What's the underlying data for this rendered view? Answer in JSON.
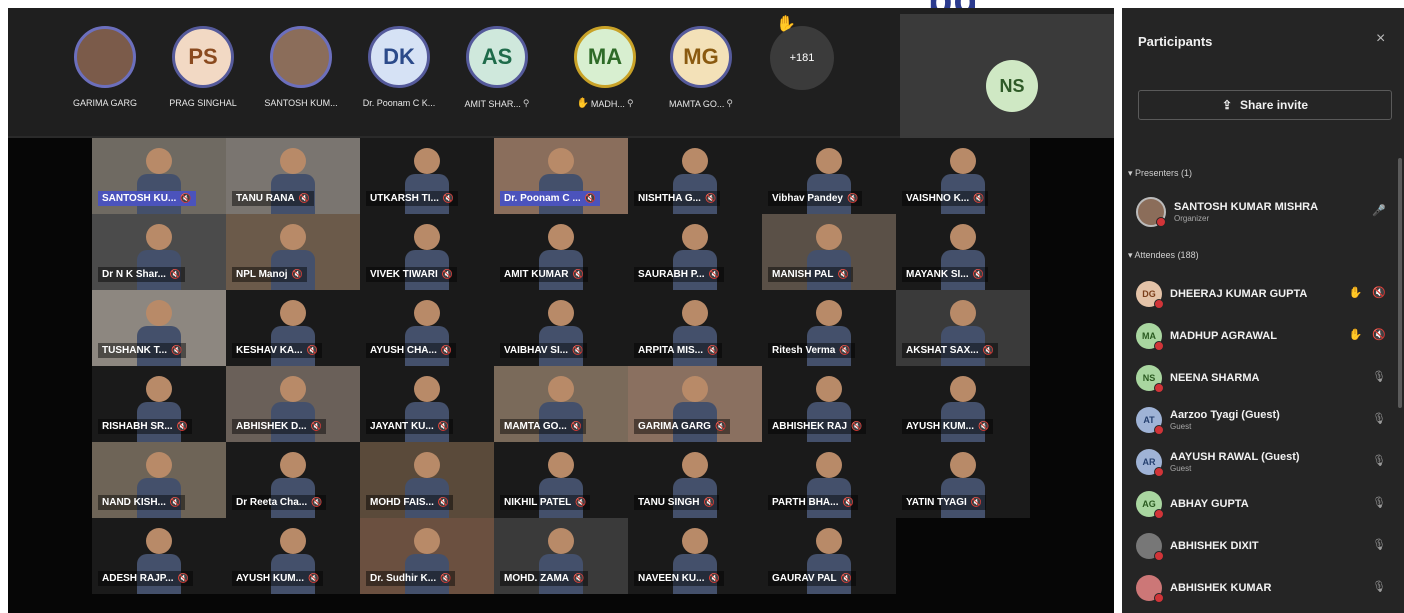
{
  "overlay_text": "p",
  "overlay_text2": "pg",
  "topbar": {
    "participants": [
      {
        "name": "GARIMA GARG",
        "initials": "",
        "photo": true,
        "bg": "#7b5b4a",
        "color": "#fff",
        "pinned": false,
        "hand": false
      },
      {
        "name": "PRAG SINGHAL",
        "initials": "PS",
        "photo": false,
        "bg": "#f2d9c4",
        "color": "#8a4a1f",
        "pinned": false,
        "hand": false
      },
      {
        "name": "SANTOSH KUM...",
        "initials": "",
        "photo": true,
        "bg": "#8b6d5a",
        "color": "#fff",
        "pinned": false,
        "hand": false
      },
      {
        "name": "Dr. Poonam C K...",
        "initials": "DK",
        "photo": false,
        "bg": "#d6e2f5",
        "color": "#2b4a8a",
        "pinned": false,
        "hand": false
      },
      {
        "name": "AMIT SHAR...",
        "initials": "AS",
        "photo": false,
        "bg": "#cfe8dc",
        "color": "#1e6b4a",
        "pinned": true,
        "hand": false
      },
      {
        "name": "MADH...",
        "initials": "MA",
        "photo": false,
        "bg": "#d8efd0",
        "color": "#2e6b27",
        "pinned": true,
        "hand": true
      },
      {
        "name": "MAMTA GO...",
        "initials": "MG",
        "photo": false,
        "bg": "#f3e1b8",
        "color": "#8a5a10",
        "pinned": true,
        "hand": false
      }
    ],
    "more_count": "+181",
    "ns_tile": {
      "initials": "NS"
    }
  },
  "grid": {
    "tiles": [
      {
        "name": "SANTOSH KU...",
        "highlight": true,
        "bg": "#6f6a62"
      },
      {
        "name": "TANU RANA",
        "highlight": false,
        "bg": "#7a7570"
      },
      {
        "name": "UTKARSH TI...",
        "highlight": false,
        "bg": "#1a1a1a"
      },
      {
        "name": "Dr. Poonam C ...",
        "highlight": true,
        "bg": "#8a6e5c"
      },
      {
        "name": "NISHTHA G...",
        "highlight": false,
        "bg": "#1a1a1a"
      },
      {
        "name": "Vibhav Pandey",
        "highlight": false,
        "bg": "#1a1a1a"
      },
      {
        "name": "VAISHNO K...",
        "highlight": false,
        "bg": "#1a1a1a"
      },
      {
        "name": "Dr N K Shar...",
        "highlight": false,
        "bg": "#4b4b4b"
      },
      {
        "name": "NPL Manoj",
        "highlight": false,
        "bg": "#6b5a4a"
      },
      {
        "name": "VIVEK TIWARI",
        "highlight": false,
        "bg": "#1a1a1a"
      },
      {
        "name": "AMIT KUMAR",
        "highlight": false,
        "bg": "#1a1a1a"
      },
      {
        "name": "SAURABH P...",
        "highlight": false,
        "bg": "#1a1a1a"
      },
      {
        "name": "MANISH PAL",
        "highlight": false,
        "bg": "#5a5047"
      },
      {
        "name": "MAYANK SI...",
        "highlight": false,
        "bg": "#1a1a1a"
      },
      {
        "name": "TUSHANK T...",
        "highlight": false,
        "bg": "#8d8780"
      },
      {
        "name": "KESHAV KA...",
        "highlight": false,
        "bg": "#1a1a1a"
      },
      {
        "name": "AYUSH CHA...",
        "highlight": false,
        "bg": "#1a1a1a"
      },
      {
        "name": "VAIBHAV SI...",
        "highlight": false,
        "bg": "#1a1a1a"
      },
      {
        "name": "ARPITA MIS...",
        "highlight": false,
        "bg": "#1a1a1a"
      },
      {
        "name": "Ritesh Verma",
        "highlight": false,
        "bg": "#1a1a1a"
      },
      {
        "name": "AKSHAT SAX...",
        "highlight": false,
        "bg": "#3a3a3a"
      },
      {
        "name": "RISHABH SR...",
        "highlight": false,
        "bg": "#1a1a1a"
      },
      {
        "name": "ABHISHEK D...",
        "highlight": false,
        "bg": "#6a6059"
      },
      {
        "name": "JAYANT KU...",
        "highlight": false,
        "bg": "#1a1a1a"
      },
      {
        "name": "MAMTA GO...",
        "highlight": false,
        "bg": "#7a6a5a"
      },
      {
        "name": "GARIMA GARG",
        "highlight": false,
        "bg": "#8a7060"
      },
      {
        "name": "ABHISHEK RAJ",
        "highlight": false,
        "bg": "#1a1a1a"
      },
      {
        "name": "AYUSH KUM...",
        "highlight": false,
        "bg": "#1a1a1a"
      },
      {
        "name": "NAND KISH...",
        "highlight": false,
        "bg": "#6e6457"
      },
      {
        "name": "Dr Reeta Cha...",
        "highlight": false,
        "bg": "#1a1a1a"
      },
      {
        "name": "MOHD FAIS...",
        "highlight": false,
        "bg": "#5a4a3a"
      },
      {
        "name": "NIKHIL PATEL",
        "highlight": false,
        "bg": "#1a1a1a"
      },
      {
        "name": "TANU SINGH",
        "highlight": false,
        "bg": "#1a1a1a"
      },
      {
        "name": "PARTH BHA...",
        "highlight": false,
        "bg": "#1a1a1a"
      },
      {
        "name": "YATIN TYAGI",
        "highlight": false,
        "bg": "#1a1a1a"
      },
      {
        "name": "ADESH RAJP...",
        "highlight": false,
        "bg": "#1a1a1a"
      },
      {
        "name": "AYUSH KUM...",
        "highlight": false,
        "bg": "#1a1a1a"
      },
      {
        "name": "Dr. Sudhir K...",
        "highlight": false,
        "bg": "#6b5040"
      },
      {
        "name": "MOHD. ZAMA",
        "highlight": false,
        "bg": "#3a3a3a"
      },
      {
        "name": "NAVEEN KU...",
        "highlight": false,
        "bg": "#1a1a1a"
      },
      {
        "name": "GAURAV PAL",
        "highlight": false,
        "bg": "#1a1a1a"
      }
    ]
  },
  "panel": {
    "title": "Participants",
    "close_icon": "×",
    "share_label": "Share invite",
    "share_icon": "share-icon",
    "presenters_label": "Presenters (1)",
    "attendees_label": "Attendees (188)",
    "presenter": {
      "name": "SANTOSH KUMAR MISHRA",
      "role": "Organizer"
    },
    "attendees": [
      {
        "name": "DHEERAJ KUMAR GUPTA",
        "initials": "DG",
        "bg": "#e4c3a8",
        "fg": "#7a3e1a",
        "sub": "",
        "hand": true,
        "muted_icon": true
      },
      {
        "name": "MADHUP AGRAWAL",
        "initials": "MA",
        "bg": "#a9d6a0",
        "fg": "#2a5a20",
        "sub": "",
        "hand": true,
        "muted_icon": true
      },
      {
        "name": "NEENA SHARMA",
        "initials": "NS",
        "bg": "#a9d6a0",
        "fg": "#2a5a20",
        "sub": "",
        "hand": false,
        "muted_icon": false
      },
      {
        "name": "Aarzoo Tyagi (Guest)",
        "initials": "AT",
        "bg": "#9fb3d6",
        "fg": "#243f6e",
        "sub": "Guest",
        "hand": false,
        "muted_icon": false
      },
      {
        "name": "AAYUSH RAWAL (Guest)",
        "initials": "AR",
        "bg": "#9fb3d6",
        "fg": "#243f6e",
        "sub": "Guest",
        "hand": false,
        "muted_icon": false
      },
      {
        "name": "ABHAY GUPTA",
        "initials": "AG",
        "bg": "#a9d6a0",
        "fg": "#2a5a20",
        "sub": "",
        "hand": false,
        "muted_icon": false
      },
      {
        "name": "ABHISHEK DIXIT",
        "initials": "",
        "bg": "#777",
        "fg": "#fff",
        "sub": "",
        "hand": false,
        "muted_icon": false
      },
      {
        "name": "ABHISHEK KUMAR",
        "initials": "",
        "bg": "#c77",
        "fg": "#fff",
        "sub": "",
        "hand": false,
        "muted_icon": false
      }
    ]
  }
}
